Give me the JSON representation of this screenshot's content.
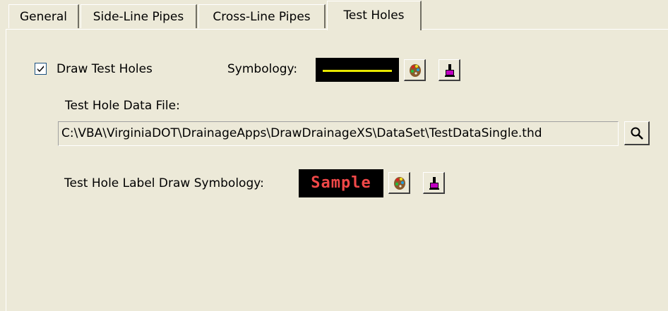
{
  "tabs": [
    {
      "label": "General",
      "active": false
    },
    {
      "label": "Side-Line Pipes",
      "active": false
    },
    {
      "label": "Cross-Line Pipes",
      "active": false
    },
    {
      "label": "Test Holes",
      "active": true
    }
  ],
  "draw_test_holes": {
    "label": "Draw Test Holes",
    "checked": true
  },
  "symbology": {
    "label": "Symbology:",
    "line_color": "#E6E600",
    "background": "#000000"
  },
  "data_file": {
    "label": "Test Hole Data File:",
    "value": "C:\\VBA\\VirginiaDOT\\DrainageApps\\DrawDrainageXS\\DataSet\\TestDataSingle.thd"
  },
  "label_symbology": {
    "label": "Test Hole Label Draw Symbology:",
    "sample_text": "Sample",
    "sample_color": "#F04848"
  },
  "icons": {
    "color_picker": "palette-icon",
    "style_picker": "paintbrush-icon",
    "browse": "magnifier-icon"
  }
}
